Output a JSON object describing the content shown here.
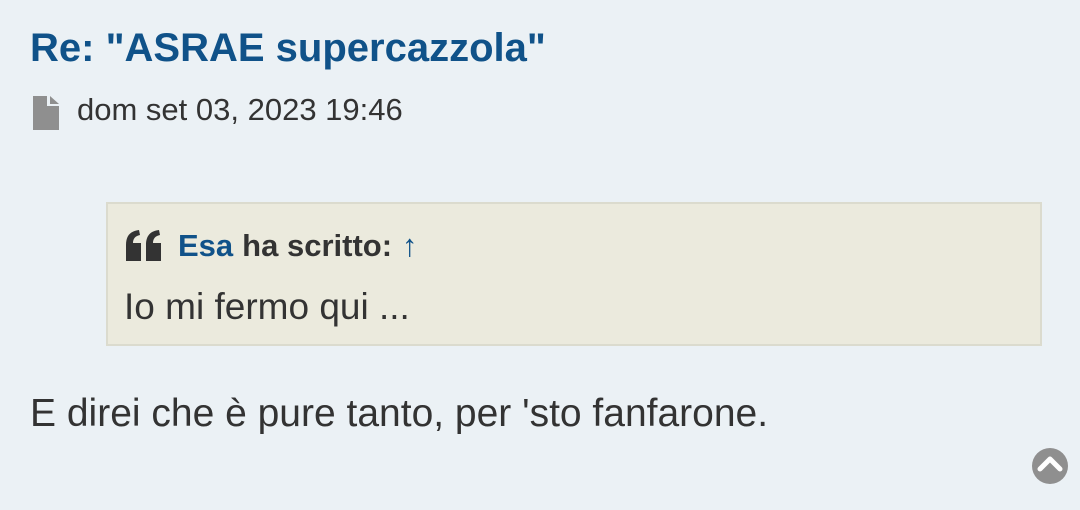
{
  "post": {
    "title": "Re: \"ASRAE supercazzola\"",
    "date": "dom set 03, 2023 19:46",
    "quote": {
      "author": "Esa",
      "wrote": "ha scritto:",
      "jump_icon": "↑",
      "text": "Io mi fermo qui ..."
    },
    "body": "E direi che è pure tanto, per 'sto fanfarone."
  },
  "icons": {
    "post": "file-icon",
    "quote": "quote-icon",
    "back_to_top": "chevron-up-circle-icon"
  },
  "colors": {
    "link": "#105289",
    "text": "#333333",
    "background": "#ebf1f5",
    "quote_background": "#ebeadd",
    "quote_border": "#dbdbce",
    "icon_gray": "#8f8f8f",
    "quote_icon": "#333333"
  }
}
